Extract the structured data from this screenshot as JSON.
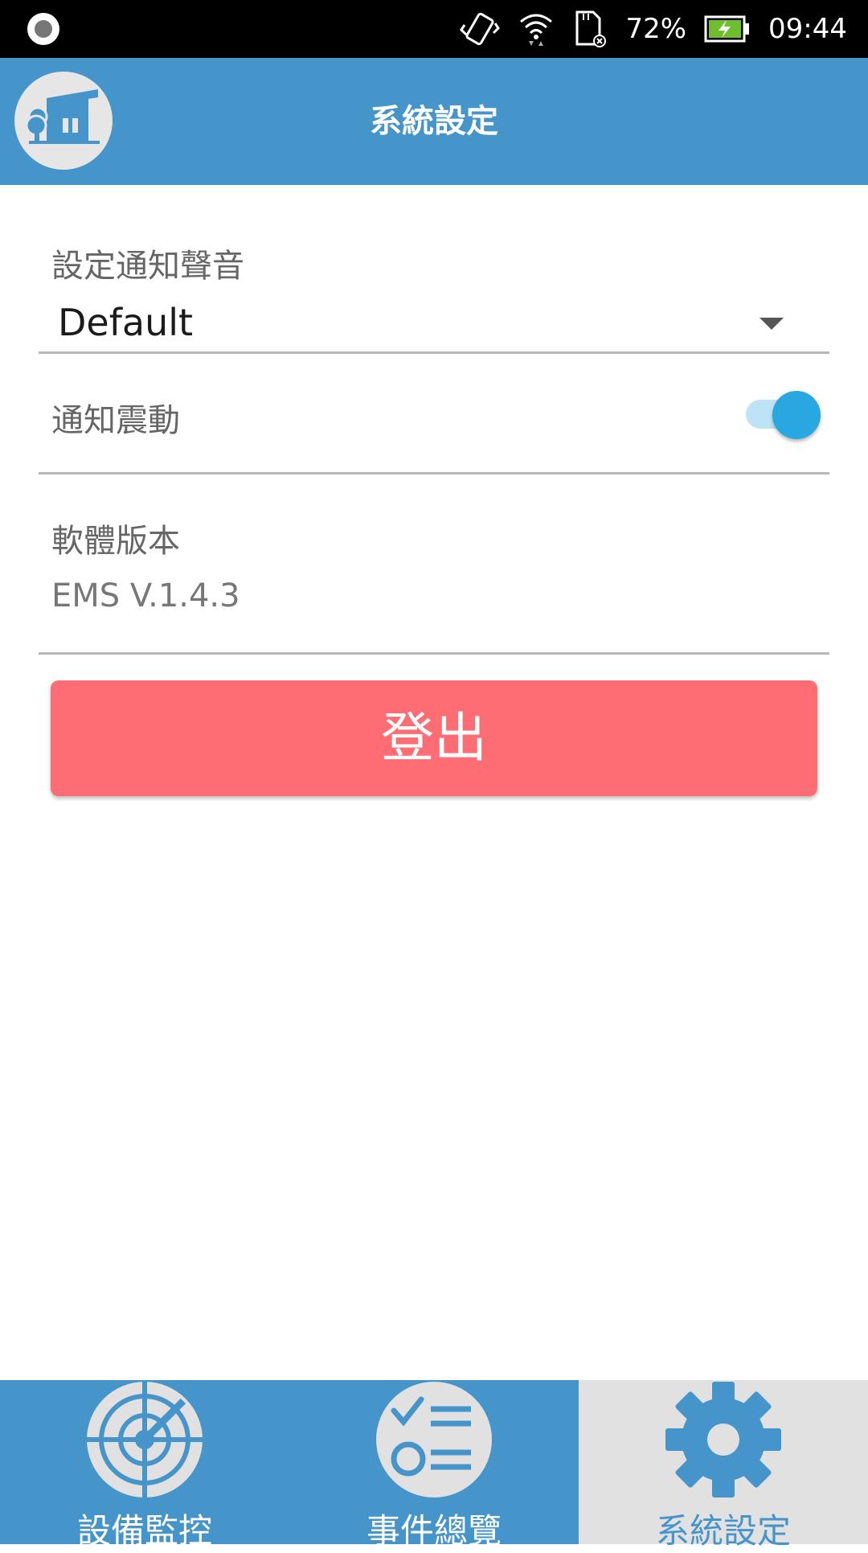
{
  "status_bar": {
    "battery": "72%",
    "time": "09:44",
    "icons": [
      "record-icon",
      "vibrate-icon",
      "wifi-icon",
      "sd-card-icon",
      "battery-charging-icon"
    ]
  },
  "app_bar": {
    "title": "系統設定",
    "logo": "house-tree-logo"
  },
  "settings": {
    "notification_sound": {
      "label": "設定通知聲音",
      "value": "Default"
    },
    "notification_vibration": {
      "label": "通知震動",
      "enabled": true
    },
    "software_version": {
      "label": "軟體版本",
      "value": "EMS V.1.4.3"
    },
    "logout_label": "登出"
  },
  "bottom_nav": {
    "items": [
      {
        "label": "設備監控",
        "icon": "radar-icon",
        "active": false
      },
      {
        "label": "事件總覽",
        "icon": "checklist-icon",
        "active": false
      },
      {
        "label": "系統設定",
        "icon": "gear-icon",
        "active": true
      }
    ]
  },
  "colors": {
    "primary": "#4595cb",
    "logout": "#ff6d74",
    "toggle_on": "#29a7e0",
    "nav_active_bg": "#e1e1e1"
  }
}
